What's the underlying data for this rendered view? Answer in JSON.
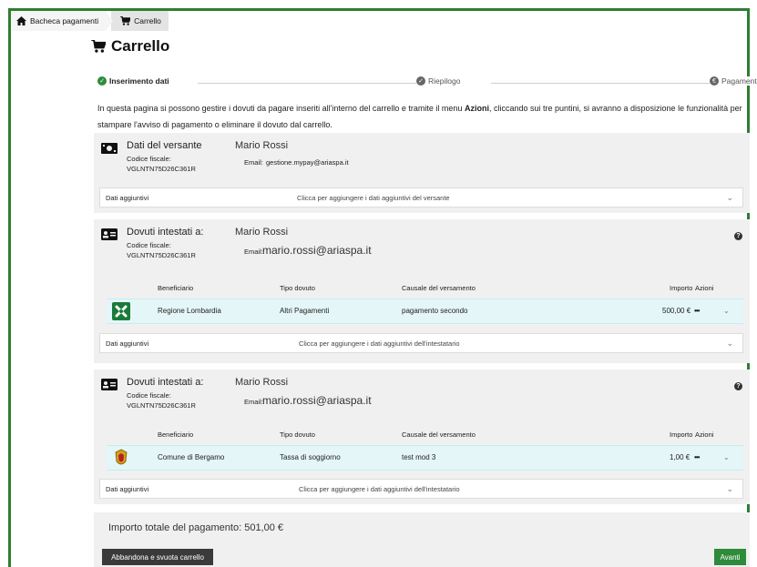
{
  "breadcrumb": {
    "home_label": "Bacheca pagamenti",
    "cart_label": "Carrello"
  },
  "page_title": "Carrello",
  "steps": [
    {
      "label": "Inserimento dati",
      "state": "done"
    },
    {
      "label": "Riepilogo",
      "state": "pending"
    },
    {
      "label": "Pagamento",
      "state": "pending"
    }
  ],
  "description": {
    "part1": "In questa pagina si possono gestire i dovuti da pagare inseriti all'interno del carrello e tramite il menu ",
    "bold": "Azioni",
    "part2": ", cliccando sui tre puntini, si avranno a disposizione le funzionalità per stampare l'avviso di pagamento o eliminare il dovuto dal carrello."
  },
  "versante": {
    "title": "Dati del versante",
    "name": "Mario Rossi",
    "cf_label": "Codice fiscale:",
    "cf_value": "VGLNTN75D26C361R",
    "email_label": "Email:",
    "email_value": "gestione.mypay@ariaspa.it",
    "extra_label": "Dati aggiuntivi",
    "extra_hint": "Clicca per aggiungere i dati aggiuntivi del versante"
  },
  "table_headers": {
    "beneficiario": "Beneficiario",
    "tipo": "Tipo dovuto",
    "causale": "Causale del versamento",
    "importo": "Importo",
    "azioni": "Azioni"
  },
  "dovuti": [
    {
      "title": "Dovuti intestati a:",
      "name": "Mario Rossi",
      "cf_label": "Codice fiscale:",
      "cf_value": "VGLNTN75D26C361R",
      "email_label": "Email:",
      "email_value": "mario.rossi@ariaspa.it",
      "row": {
        "beneficiario": "Regione Lombardia",
        "tipo": "Altri Pagamenti",
        "causale": "pagamento secondo",
        "importo": "500,00 €",
        "actions": "•••"
      },
      "extra_label": "Dati aggiuntivi",
      "extra_hint": "Clicca per aggiungere i dati aggiuntivi dell'intestatario"
    },
    {
      "title": "Dovuti intestati a:",
      "name": "Mario Rossi",
      "cf_label": "Codice fiscale:",
      "cf_value": "VGLNTN75D26C361R",
      "email_label": "Email:",
      "email_value": "mario.rossi@ariaspa.it",
      "row": {
        "beneficiario": "Comune di Bergamo",
        "tipo": "Tassa di soggiorno",
        "causale": "test mod 3",
        "importo": "1,00 €",
        "actions": "•••"
      },
      "extra_label": "Dati aggiuntivi",
      "extra_hint": "Clicca per aggiungere i dati aggiuntivi dell'intestatario"
    }
  ],
  "total": "Importo totale del pagamento: 501,00 €",
  "buttons": {
    "abandon": "Abbandona e svuota carrello",
    "next": "Avanti"
  },
  "colors": {
    "accent_green": "#2e8b3a",
    "row_highlight": "#e4f6f7",
    "card_bg": "#f0f0f0"
  }
}
